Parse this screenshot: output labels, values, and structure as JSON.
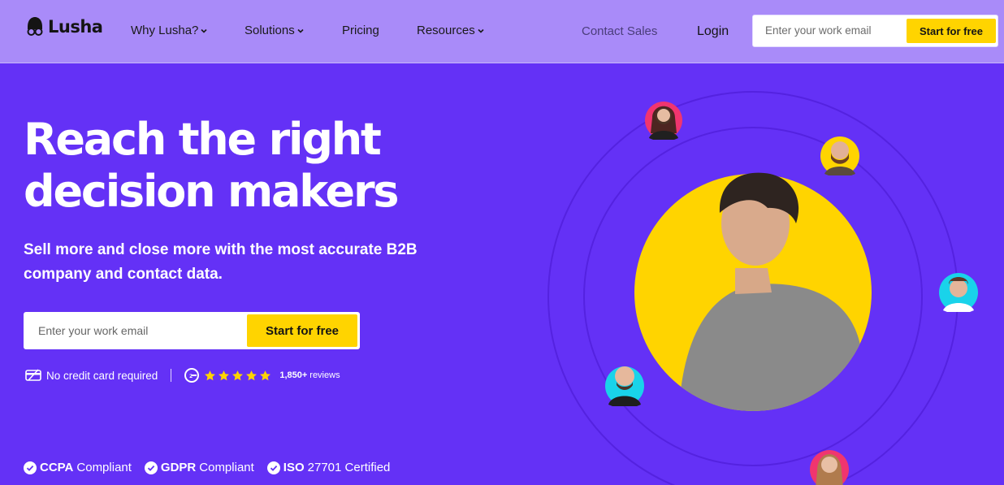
{
  "nav": {
    "logo_text": "Lusha",
    "items": [
      {
        "label": "Why Lusha?",
        "dropdown": true
      },
      {
        "label": "Solutions",
        "dropdown": true
      },
      {
        "label": "Pricing",
        "dropdown": false
      },
      {
        "label": "Resources",
        "dropdown": true
      }
    ],
    "contact_sales": "Contact Sales",
    "login": "Login",
    "email_placeholder": "Enter your work email",
    "cta": "Start for free"
  },
  "hero": {
    "headline_line1": "Reach the right",
    "headline_line2": "decision makers",
    "subline_line1": "Sell more and close more with the most accurate B2B",
    "subline_line2": "company and contact data.",
    "email_placeholder": "Enter your work email",
    "cta": "Start for free",
    "no_card": "No credit card required",
    "rating_stars": 5,
    "reviews_count": "1,850+",
    "reviews_label": "reviews"
  },
  "badges": [
    {
      "strong": "CCPA",
      "rest": "Compliant"
    },
    {
      "strong": "GDPR",
      "rest": "Compliant"
    },
    {
      "strong": "ISO",
      "rest": "27701 Certified"
    }
  ],
  "colors": {
    "background": "#6431f6",
    "nav": "#a98bf9",
    "accent_yellow": "#ffd400",
    "orbit_ring": "#5422e0"
  }
}
